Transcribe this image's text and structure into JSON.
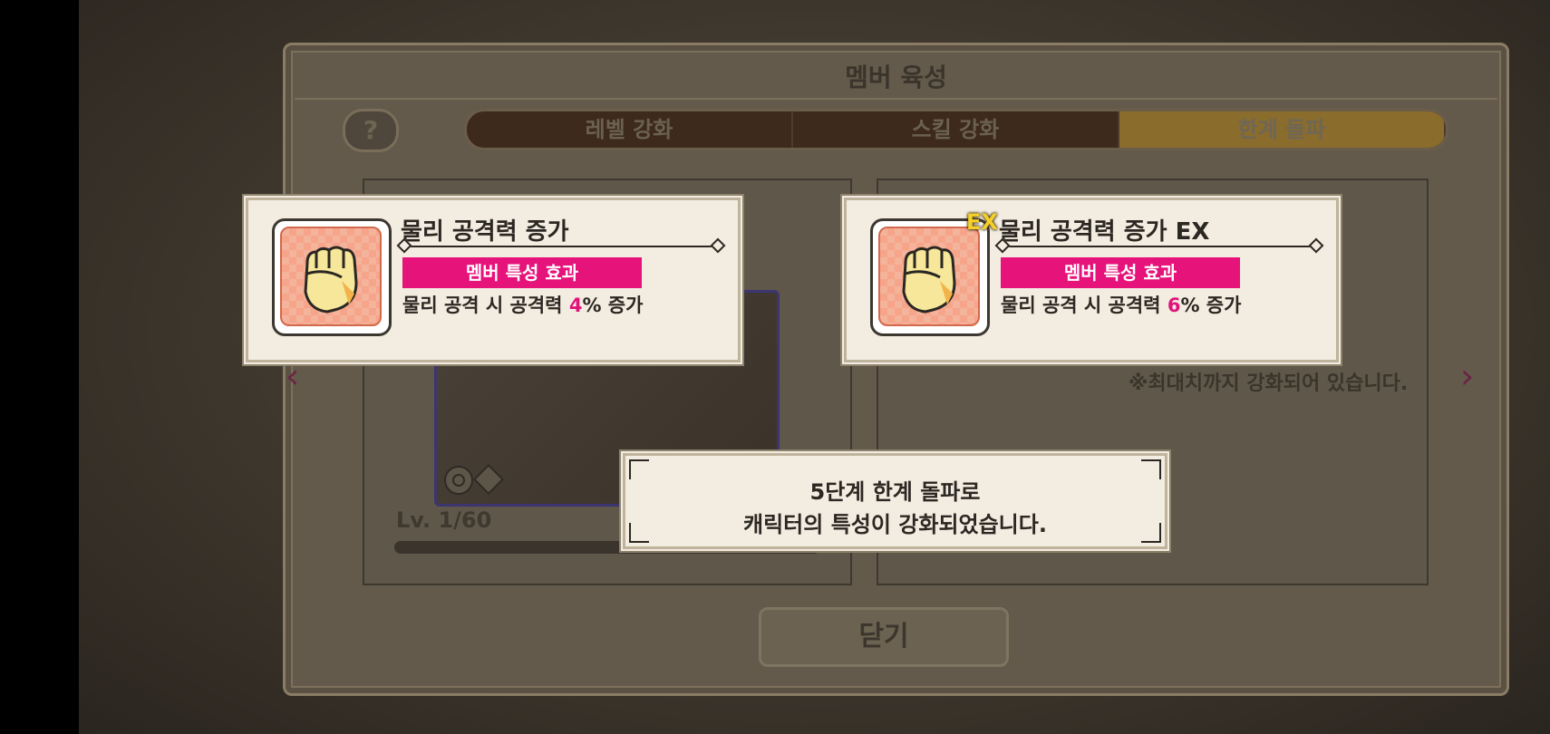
{
  "window": {
    "title": "멤버 육성",
    "help_label": "?"
  },
  "tabs": [
    {
      "label": "레벨 강화"
    },
    {
      "label": "스킬 강화"
    },
    {
      "label": "한계 돌파"
    }
  ],
  "character": {
    "level": "Lv. 1/60"
  },
  "close_label": "닫기",
  "skill_before": {
    "name": "물리 공격력 증가",
    "tag": "멤버 특성 효과",
    "desc_prefix": "물리 공격 시 공격력 ",
    "desc_value": "4",
    "desc_suffix": "% 증가",
    "icon": "fist-icon"
  },
  "skill_after": {
    "name": "물리 공격력 증가 EX",
    "badge": "EX",
    "tag": "멤버 특성 효과",
    "desc_prefix": "물리 공격 시 공격력 ",
    "desc_value": "6",
    "desc_suffix": "% 증가",
    "icon": "fist-icon"
  },
  "max_note": "※최대치까지 강화되어 있습니다.",
  "message": {
    "line1": "5단계 한계 돌파로",
    "line2": "캐릭터의 특성이 강화되었습니다."
  },
  "colors": {
    "accent_pink": "#e5137a",
    "highlight": "#e0137a",
    "card_bg": "#f3ece0"
  }
}
